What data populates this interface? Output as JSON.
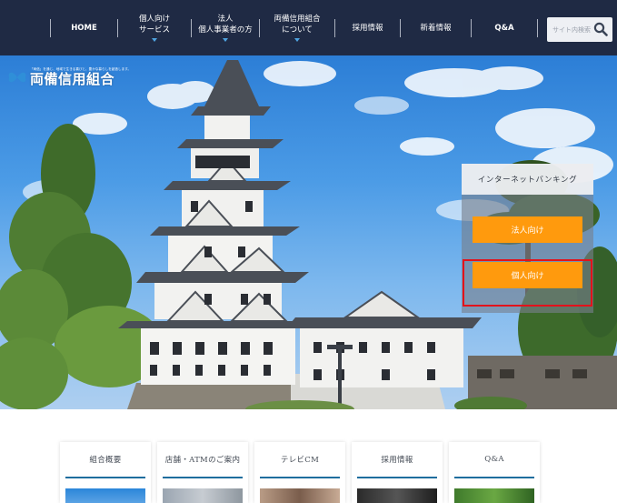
{
  "nav": {
    "items": [
      {
        "line1": "HOME",
        "line2": "",
        "has_dropdown": false
      },
      {
        "line1": "個人向け",
        "line2": "サービス",
        "has_dropdown": true
      },
      {
        "line1": "法人",
        "line2": "個人事業者の方",
        "has_dropdown": true
      },
      {
        "line1": "両備信用組合",
        "line2": "について",
        "has_dropdown": true
      },
      {
        "line1": "採用情報",
        "line2": "",
        "has_dropdown": false
      },
      {
        "line1": "新着情報",
        "line2": "",
        "has_dropdown": false
      },
      {
        "line1": "Q&A",
        "line2": "",
        "has_dropdown": false
      }
    ],
    "search_placeholder": "サイト内検索",
    "search_icon": "search-icon",
    "background_color": "#1f2a44",
    "dropdown_caret_color": "#4ea3e0"
  },
  "hero": {
    "logo_tagline": "「両信」を通じ、地域で生きる喜びと、豊かな暮らしを創造します。",
    "logo_name": "両備信用組合",
    "internet_banking": {
      "title": "インターネットバンキング",
      "corporate_button": "法人向け",
      "personal_button": "個人向け",
      "button_color": "#ff9a0d",
      "highlight_color": "#e3121b"
    }
  },
  "tiles": [
    {
      "label": "組合概要"
    },
    {
      "label": "店舗・ATMのご案内"
    },
    {
      "label": "テレビCM"
    },
    {
      "label": "採用情報"
    },
    {
      "label": "Q&A"
    }
  ],
  "accent_color": "#1f6e9e"
}
